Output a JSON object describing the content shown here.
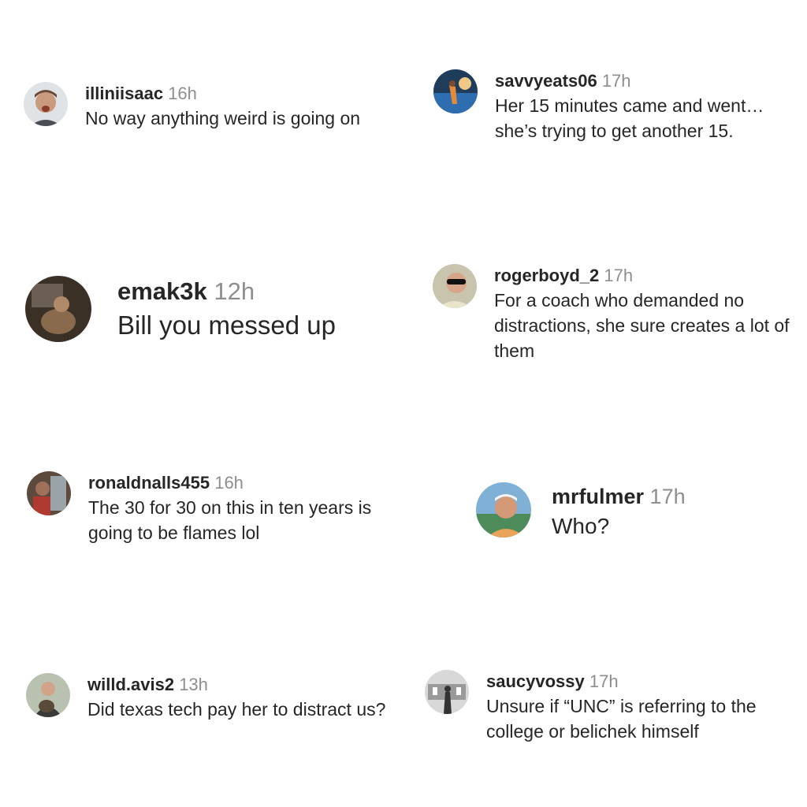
{
  "comments": [
    {
      "username": "illiniisaac",
      "time": "16h",
      "text": "No way anything weird is going on",
      "avatar": "avatar-icon"
    },
    {
      "username": "savvyeats06",
      "time": "17h",
      "text": "Her 15 minutes came and went… she’s trying to get another 15.",
      "avatar": "avatar-icon"
    },
    {
      "username": "emak3k",
      "time": "12h",
      "text": "Bill you messed up",
      "avatar": "avatar-icon"
    },
    {
      "username": "rogerboyd_2",
      "time": "17h",
      "text": "For a coach who demanded no distractions, she sure creates a lot of them",
      "avatar": "avatar-icon"
    },
    {
      "username": "ronaldnalls455",
      "time": "16h",
      "text": "The 30 for 30 on this in ten years is going to be flames lol",
      "avatar": "avatar-icon"
    },
    {
      "username": "mrfulmer",
      "time": "17h",
      "text": "Who?",
      "avatar": "avatar-icon"
    },
    {
      "username": "willd.avis2",
      "time": "13h",
      "text": "Did texas tech pay her to distract us?",
      "avatar": "avatar-icon"
    },
    {
      "username": "saucyvossy",
      "time": "17h",
      "text": "Unsure if “UNC” is referring to the college or belichek himself",
      "avatar": "avatar-icon"
    }
  ]
}
